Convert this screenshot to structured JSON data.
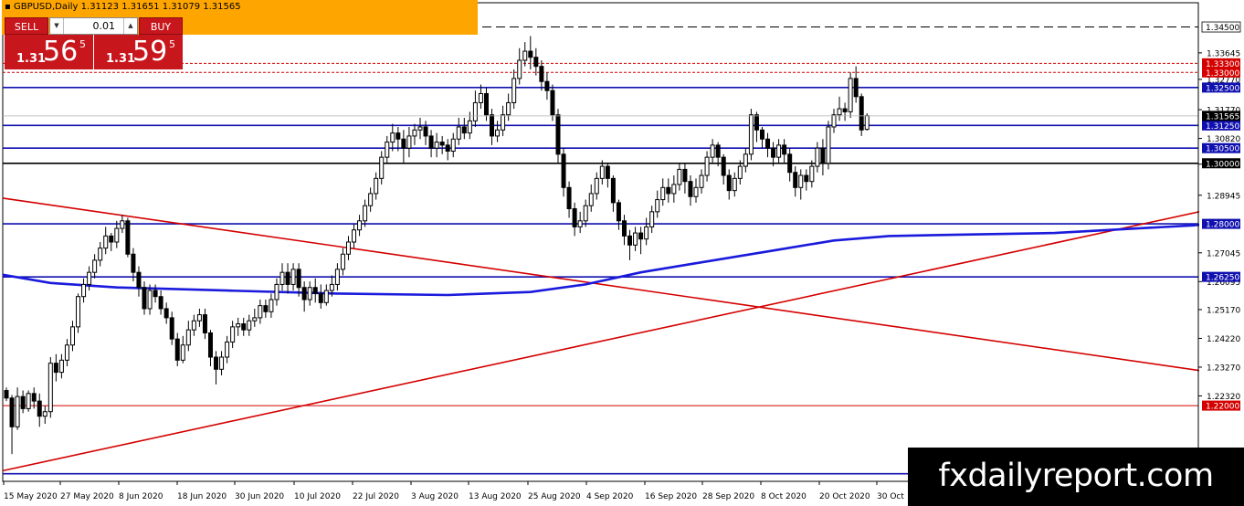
{
  "header": {
    "symbol": "GBPUSD,Daily",
    "ohlc": "1.31123 1.31651 1.31079 1.31565"
  },
  "trade_panel": {
    "sell_label": "SELL",
    "buy_label": "BUY",
    "lot_value": "0.01",
    "sell_price": {
      "prefix": "1.31",
      "big": "56",
      "sup": "5"
    },
    "buy_price": {
      "prefix": "1.31",
      "big": "59",
      "sup": "5"
    },
    "color": "#c8161d"
  },
  "watermark": "fxdailyreport.com",
  "chart_data": {
    "type": "candlestick",
    "symbol": "GBPUSD",
    "timeframe": "Daily",
    "ylim": [
      1.195,
      1.353
    ],
    "yticks": [
      "1.33645",
      "1.32770",
      "1.31770",
      "1.30820",
      "1.29970",
      "1.28945",
      "1.27045",
      "1.26095",
      "1.25170",
      "1.24220",
      "1.23270",
      "1.22320"
    ],
    "xticks": [
      "15 May 2020",
      "27 May 2020",
      "8 Jun 2020",
      "18 Jun 2020",
      "30 Jun 2020",
      "10 Jul 2020",
      "22 Jul 2020",
      "3 Aug 2020",
      "13 Aug 2020",
      "25 Aug 2020",
      "4 Sep 2020",
      "16 Sep 2020",
      "28 Sep 2020",
      "8 Oct 2020",
      "20 Oct 2020",
      "30 Oct"
    ],
    "current_price": {
      "value": 1.31565,
      "label": "1.31565"
    },
    "horizontal_levels": [
      {
        "value": 1.345,
        "label": "1.34500",
        "color": "#000000",
        "style": "dashed"
      },
      {
        "value": 1.333,
        "label": "1.33300",
        "color": "#d40000",
        "style": "dotted"
      },
      {
        "value": 1.33,
        "label": "1.33000",
        "color": "#d40000",
        "style": "dotted"
      },
      {
        "value": 1.325,
        "label": "1.32500",
        "color": "#1010b0",
        "style": "solid"
      },
      {
        "value": 1.3125,
        "label": "1.31250",
        "color": "#1010b0",
        "style": "solid"
      },
      {
        "value": 1.305,
        "label": "1.30500",
        "color": "#1010b0",
        "style": "solid"
      },
      {
        "value": 1.3,
        "label": "1.30000",
        "color": "#000000",
        "style": "solid"
      },
      {
        "value": 1.28,
        "label": "1.28000",
        "color": "#1010b0",
        "style": "solid"
      },
      {
        "value": 1.2625,
        "label": "1.26250",
        "color": "#1010b0",
        "style": "solid"
      },
      {
        "value": 1.22,
        "label": "1.22000",
        "color": "#d40000",
        "style": "solid"
      },
      {
        "value": 1.1975,
        "label": "",
        "color": "#1010b0",
        "style": "solid"
      }
    ],
    "trendlines": [
      {
        "from": [
          0,
          1.2885
        ],
        "to": [
          270,
          1.2175
        ],
        "color": "#d40000"
      },
      {
        "from": [
          0,
          1.1985
        ],
        "to": [
          270,
          1.3052
        ],
        "color": "#d40000"
      }
    ],
    "moving_average": {
      "color": "#1a1adc",
      "points": [
        [
          0,
          1.2632
        ],
        [
          8,
          1.2605
        ],
        [
          20,
          1.259
        ],
        [
          40,
          1.258
        ],
        [
          60,
          1.257
        ],
        [
          80,
          1.2565
        ],
        [
          95,
          1.2575
        ],
        [
          105,
          1.26
        ],
        [
          115,
          1.264
        ],
        [
          125,
          1.267
        ],
        [
          140,
          1.2715
        ],
        [
          150,
          1.2745
        ],
        [
          160,
          1.276
        ],
        [
          175,
          1.2765
        ],
        [
          190,
          1.277
        ],
        [
          205,
          1.2785
        ],
        [
          215,
          1.2795
        ],
        [
          225,
          1.281
        ],
        [
          235,
          1.282
        ],
        [
          245,
          1.2832
        ],
        [
          252,
          1.2842
        ]
      ]
    },
    "arrows": [
      {
        "from": [
          254,
          1.3165
        ],
        "to": [
          262,
          1.3255
        ],
        "color": "#ffee00"
      },
      {
        "from": [
          254,
          1.3165
        ],
        "to": [
          262,
          1.3115
        ],
        "color": "#ffee00"
      }
    ],
    "candles": [
      [
        1.225,
        1.2225,
        1.2215,
        1.226
      ],
      [
        1.2225,
        1.213,
        1.204,
        1.2235
      ],
      [
        1.213,
        1.223,
        1.212,
        1.226
      ],
      [
        1.223,
        1.219,
        1.2175,
        1.225
      ],
      [
        1.219,
        1.224,
        1.218,
        1.225
      ],
      [
        1.224,
        1.2215,
        1.219,
        1.226
      ],
      [
        1.2215,
        1.2165,
        1.213,
        1.224
      ],
      [
        1.2165,
        1.218,
        1.214,
        1.22
      ],
      [
        1.218,
        1.234,
        1.216,
        1.236
      ],
      [
        1.234,
        1.231,
        1.228,
        1.237
      ],
      [
        1.231,
        1.235,
        1.229,
        1.237
      ],
      [
        1.235,
        1.24,
        1.233,
        1.242
      ],
      [
        1.24,
        1.246,
        1.238,
        1.248
      ],
      [
        1.246,
        1.256,
        1.244,
        1.257
      ],
      [
        1.256,
        1.26,
        1.254,
        1.262
      ],
      [
        1.26,
        1.264,
        1.258,
        1.266
      ],
      [
        1.264,
        1.268,
        1.262,
        1.27
      ],
      [
        1.268,
        1.272,
        1.266,
        1.274
      ],
      [
        1.272,
        1.276,
        1.27,
        1.279
      ],
      [
        1.276,
        1.274,
        1.271,
        1.277
      ],
      [
        1.274,
        1.2785,
        1.272,
        1.281
      ],
      [
        1.2785,
        1.281,
        1.277,
        1.283
      ],
      [
        1.281,
        1.27,
        1.269,
        1.282
      ],
      [
        1.27,
        1.264,
        1.261,
        1.272
      ],
      [
        1.264,
        1.259,
        1.256,
        1.266
      ],
      [
        1.259,
        1.252,
        1.25,
        1.261
      ],
      [
        1.252,
        1.258,
        1.25,
        1.26
      ],
      [
        1.258,
        1.256,
        1.254,
        1.26
      ],
      [
        1.256,
        1.252,
        1.25,
        1.258
      ],
      [
        1.252,
        1.249,
        1.247,
        1.254
      ],
      [
        1.249,
        1.242,
        1.24,
        1.251
      ],
      [
        1.242,
        1.235,
        1.233,
        1.244
      ],
      [
        1.235,
        1.24,
        1.234,
        1.243
      ],
      [
        1.24,
        1.245,
        1.238,
        1.248
      ],
      [
        1.245,
        1.248,
        1.243,
        1.25
      ],
      [
        1.248,
        1.25,
        1.246,
        1.252
      ],
      [
        1.25,
        1.244,
        1.242,
        1.252
      ],
      [
        1.244,
        1.236,
        1.233,
        1.245
      ],
      [
        1.236,
        1.232,
        1.227,
        1.238
      ],
      [
        1.232,
        1.236,
        1.23,
        1.238
      ],
      [
        1.236,
        1.241,
        1.234,
        1.243
      ],
      [
        1.241,
        1.246,
        1.239,
        1.248
      ],
      [
        1.246,
        1.247,
        1.243,
        1.249
      ],
      [
        1.247,
        1.245,
        1.243,
        1.249
      ],
      [
        1.245,
        1.248,
        1.243,
        1.25
      ],
      [
        1.248,
        1.249,
        1.246,
        1.252
      ],
      [
        1.249,
        1.253,
        1.247,
        1.255
      ],
      [
        1.253,
        1.251,
        1.249,
        1.255
      ],
      [
        1.251,
        1.255,
        1.249,
        1.257
      ],
      [
        1.255,
        1.26,
        1.253,
        1.262
      ],
      [
        1.26,
        1.264,
        1.258,
        1.267
      ],
      [
        1.264,
        1.26,
        1.257,
        1.267
      ],
      [
        1.26,
        1.265,
        1.258,
        1.267
      ],
      [
        1.265,
        1.259,
        1.256,
        1.267
      ],
      [
        1.259,
        1.255,
        1.251,
        1.261
      ],
      [
        1.255,
        1.259,
        1.253,
        1.261
      ],
      [
        1.259,
        1.257,
        1.254,
        1.262
      ],
      [
        1.257,
        1.254,
        1.252,
        1.26
      ],
      [
        1.254,
        1.258,
        1.253,
        1.26
      ],
      [
        1.258,
        1.26,
        1.256,
        1.263
      ],
      [
        1.26,
        1.265,
        1.258,
        1.267
      ],
      [
        1.265,
        1.27,
        1.263,
        1.272
      ],
      [
        1.27,
        1.274,
        1.268,
        1.276
      ],
      [
        1.274,
        1.278,
        1.272,
        1.28
      ],
      [
        1.278,
        1.281,
        1.276,
        1.283
      ],
      [
        1.281,
        1.286,
        1.279,
        1.288
      ],
      [
        1.286,
        1.29,
        1.284,
        1.292
      ],
      [
        1.29,
        1.295,
        1.288,
        1.297
      ],
      [
        1.295,
        1.302,
        1.293,
        1.304
      ],
      [
        1.302,
        1.307,
        1.3,
        1.309
      ],
      [
        1.307,
        1.31,
        1.304,
        1.313
      ],
      [
        1.31,
        1.308,
        1.304,
        1.312
      ],
      [
        1.308,
        1.305,
        1.3,
        1.311
      ],
      [
        1.305,
        1.309,
        1.302,
        1.312
      ],
      [
        1.309,
        1.311,
        1.306,
        1.313
      ],
      [
        1.311,
        1.312,
        1.308,
        1.315
      ],
      [
        1.312,
        1.309,
        1.306,
        1.314
      ],
      [
        1.309,
        1.305,
        1.302,
        1.311
      ],
      [
        1.305,
        1.307,
        1.302,
        1.31
      ],
      [
        1.307,
        1.306,
        1.303,
        1.309
      ],
      [
        1.306,
        1.304,
        1.301,
        1.308
      ],
      [
        1.304,
        1.308,
        1.302,
        1.31
      ],
      [
        1.308,
        1.312,
        1.306,
        1.315
      ],
      [
        1.312,
        1.31,
        1.308,
        1.315
      ],
      [
        1.31,
        1.314,
        1.308,
        1.317
      ],
      [
        1.314,
        1.32,
        1.312,
        1.324
      ],
      [
        1.32,
        1.323,
        1.318,
        1.326
      ],
      [
        1.323,
        1.316,
        1.314,
        1.325
      ],
      [
        1.316,
        1.309,
        1.306,
        1.318
      ],
      [
        1.309,
        1.311,
        1.307,
        1.314
      ],
      [
        1.311,
        1.316,
        1.309,
        1.319
      ],
      [
        1.316,
        1.32,
        1.314,
        1.323
      ],
      [
        1.32,
        1.328,
        1.318,
        1.331
      ],
      [
        1.328,
        1.334,
        1.326,
        1.338
      ],
      [
        1.334,
        1.337,
        1.332,
        1.34
      ],
      [
        1.337,
        1.335,
        1.331,
        1.342
      ],
      [
        1.335,
        1.332,
        1.329,
        1.338
      ],
      [
        1.332,
        1.327,
        1.324,
        1.334
      ],
      [
        1.327,
        1.324,
        1.321,
        1.33
      ],
      [
        1.324,
        1.316,
        1.314,
        1.326
      ],
      [
        1.316,
        1.303,
        1.3,
        1.318
      ],
      [
        1.303,
        1.292,
        1.289,
        1.305
      ],
      [
        1.292,
        1.285,
        1.282,
        1.294
      ],
      [
        1.285,
        1.279,
        1.276,
        1.287
      ],
      [
        1.279,
        1.281,
        1.277,
        1.284
      ],
      [
        1.281,
        1.286,
        1.279,
        1.288
      ],
      [
        1.286,
        1.29,
        1.284,
        1.293
      ],
      [
        1.29,
        1.295,
        1.288,
        1.297
      ],
      [
        1.295,
        1.299,
        1.293,
        1.301
      ],
      [
        1.299,
        1.295,
        1.292,
        1.3
      ],
      [
        1.295,
        1.287,
        1.284,
        1.296
      ],
      [
        1.287,
        1.281,
        1.278,
        1.288
      ],
      [
        1.281,
        1.276,
        1.273,
        1.283
      ],
      [
        1.276,
        1.273,
        1.268,
        1.278
      ],
      [
        1.273,
        1.277,
        1.271,
        1.279
      ],
      [
        1.277,
        1.275,
        1.27,
        1.279
      ],
      [
        1.275,
        1.279,
        1.273,
        1.282
      ],
      [
        1.279,
        1.284,
        1.277,
        1.286
      ],
      [
        1.284,
        1.288,
        1.282,
        1.291
      ],
      [
        1.288,
        1.292,
        1.286,
        1.295
      ],
      [
        1.292,
        1.29,
        1.287,
        1.295
      ],
      [
        1.29,
        1.293,
        1.287,
        1.296
      ],
      [
        1.293,
        1.298,
        1.291,
        1.3
      ],
      [
        1.298,
        1.294,
        1.29,
        1.3
      ],
      [
        1.294,
        1.289,
        1.286,
        1.296
      ],
      [
        1.289,
        1.292,
        1.287,
        1.295
      ],
      [
        1.292,
        1.296,
        1.29,
        1.298
      ],
      [
        1.296,
        1.302,
        1.294,
        1.304
      ],
      [
        1.302,
        1.306,
        1.3,
        1.308
      ],
      [
        1.306,
        1.302,
        1.299,
        1.307
      ],
      [
        1.302,
        1.296,
        1.293,
        1.303
      ],
      [
        1.296,
        1.291,
        1.288,
        1.298
      ],
      [
        1.291,
        1.295,
        1.289,
        1.297
      ],
      [
        1.295,
        1.299,
        1.293,
        1.301
      ],
      [
        1.299,
        1.303,
        1.297,
        1.305
      ],
      [
        1.303,
        1.316,
        1.301,
        1.318
      ],
      [
        1.316,
        1.311,
        1.307,
        1.317
      ],
      [
        1.311,
        1.308,
        1.305,
        1.312
      ],
      [
        1.308,
        1.305,
        1.302,
        1.31
      ],
      [
        1.305,
        1.302,
        1.299,
        1.307
      ],
      [
        1.302,
        1.306,
        1.3,
        1.308
      ],
      [
        1.306,
        1.303,
        1.3,
        1.308
      ],
      [
        1.303,
        1.297,
        1.294,
        1.305
      ],
      [
        1.297,
        1.292,
        1.289,
        1.299
      ],
      [
        1.292,
        1.296,
        1.288,
        1.298
      ],
      [
        1.296,
        1.294,
        1.291,
        1.298
      ],
      [
        1.294,
        1.299,
        1.292,
        1.301
      ],
      [
        1.299,
        1.305,
        1.297,
        1.307
      ],
      [
        1.305,
        1.3,
        1.296,
        1.308
      ],
      [
        1.3,
        1.312,
        1.298,
        1.314
      ],
      [
        1.312,
        1.316,
        1.31,
        1.318
      ],
      [
        1.316,
        1.318,
        1.314,
        1.322
      ],
      [
        1.318,
        1.317,
        1.314,
        1.32
      ],
      [
        1.317,
        1.328,
        1.315,
        1.33
      ],
      [
        1.328,
        1.322,
        1.32,
        1.332
      ],
      [
        1.322,
        1.311,
        1.309,
        1.323
      ],
      [
        1.3112,
        1.3157,
        1.3108,
        1.3165
      ]
    ]
  }
}
